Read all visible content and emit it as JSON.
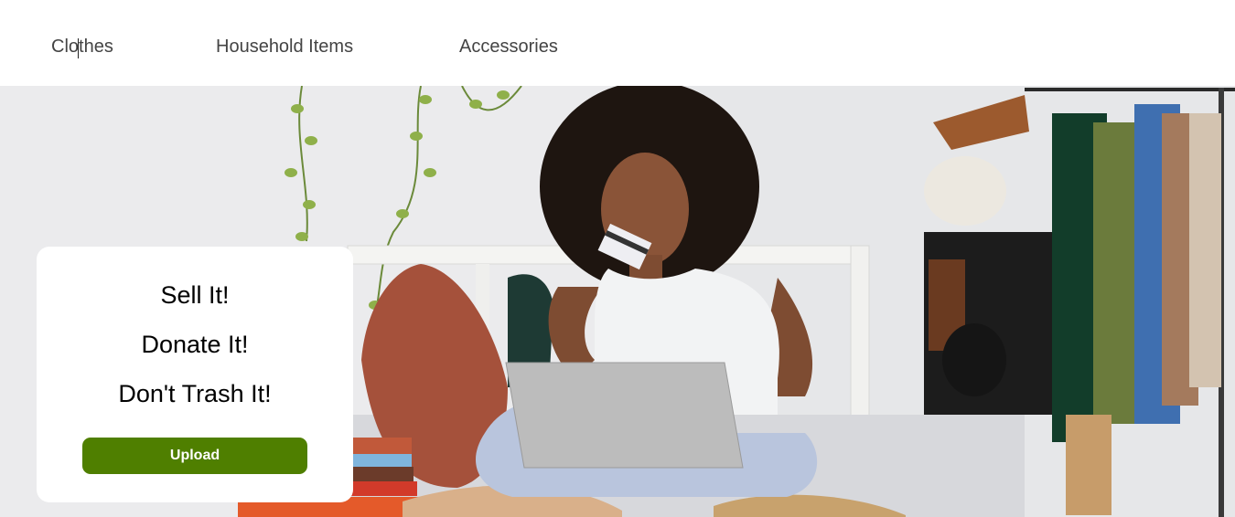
{
  "nav": {
    "items": [
      {
        "label": "Clothes"
      },
      {
        "label": "Household Items"
      },
      {
        "label": "Accessories"
      }
    ]
  },
  "promo": {
    "line1": "Sell It!",
    "line2": "Donate It!",
    "line3": "Don't Trash It!",
    "upload_label": "Upload"
  },
  "colors": {
    "upload_button": "#4f7f00",
    "nav_text": "#444444"
  }
}
